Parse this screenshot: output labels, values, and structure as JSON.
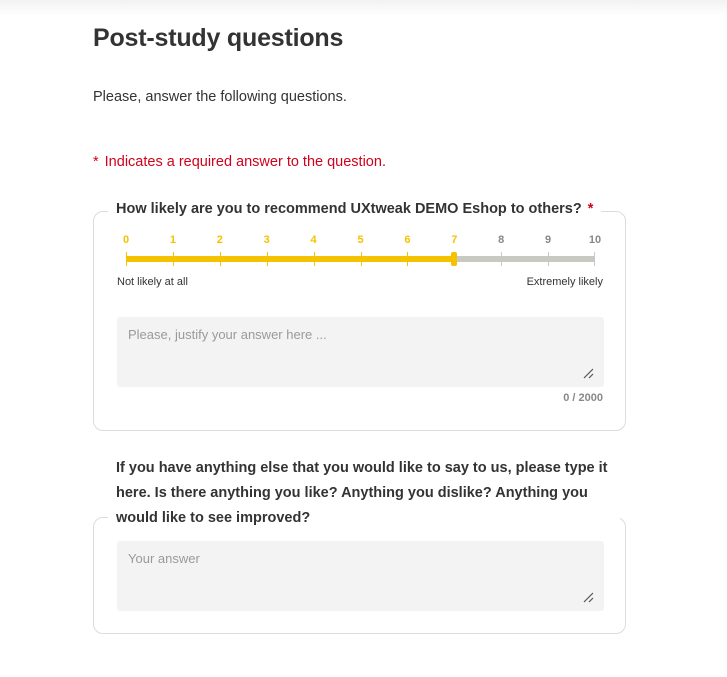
{
  "page": {
    "title": "Post-study questions",
    "intro": "Please, answer the following questions.",
    "required_star": "*",
    "required_note": "Indicates a required answer to the question."
  },
  "question1": {
    "label": "How likely are you to recommend UXtweak DEMO Eshop to others?",
    "required_star": "*",
    "scale": [
      "0",
      "1",
      "2",
      "3",
      "4",
      "5",
      "6",
      "7",
      "8",
      "9",
      "10"
    ],
    "selected_value": 7,
    "min_label": "Not likely at all",
    "max_label": "Extremely likely",
    "placeholder": "Please, justify your answer here ...",
    "counter": "0 / 2000",
    "active_color": "#f5c200",
    "inactive_color": "#c9c9c4"
  },
  "question2": {
    "label": "If you have anything else that you would like to say to us, please type it here. Is there anything you like? Anything you dislike? Anything you would like to see improved?",
    "placeholder": "Your answer"
  }
}
